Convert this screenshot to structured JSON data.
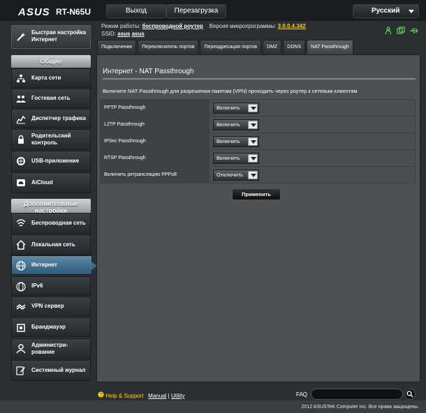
{
  "header": {
    "logo": "ASUS",
    "model": "RT-N65U",
    "logout_label": "Выход",
    "reboot_label": "Перезагрузка",
    "language": "Русский"
  },
  "status": {
    "mode_label": "Режим работы:",
    "mode_value": "беспроводной роутер",
    "firmware_label": "Версия микропрограммы:",
    "firmware_value": "3.0.0.4.342",
    "ssid_label": "SSID:",
    "ssid_1": "asus",
    "ssid_2": "asus"
  },
  "sidebar": {
    "quick_setup": "Быстрая настройка Интернет",
    "general_title": "Общие",
    "general_items": [
      {
        "label": "Карта сети"
      },
      {
        "label": "Гостевая сеть"
      },
      {
        "label": "Диспетчер трафика"
      },
      {
        "label": "Родительский контроль"
      },
      {
        "label": "USB-приложение"
      },
      {
        "label": "AiCloud"
      }
    ],
    "advanced_title": "Дополнительные настройки",
    "advanced_items": [
      {
        "label": "Беспроводная сеть"
      },
      {
        "label": "Локальная сеть"
      },
      {
        "label": "Интернет"
      },
      {
        "label": "IPv6"
      },
      {
        "label": "VPN сервер"
      },
      {
        "label": "Брандмауэр"
      },
      {
        "label": "Администри-рование"
      },
      {
        "label": "Системный журнал"
      }
    ]
  },
  "tabs": [
    {
      "label": "Подключение"
    },
    {
      "label": "Переключатель портов"
    },
    {
      "label": "Переадресация портов"
    },
    {
      "label": "DMZ"
    },
    {
      "label": "DDNS"
    },
    {
      "label": "NAT Passthrough"
    }
  ],
  "main": {
    "title": "Интернет - NAT Passthrough",
    "description": "Включите NAT Passthrough для разрешения пакетам (VPN) проходить через роутер к сетевым клиентам",
    "rows": [
      {
        "label": "PPTP Passthrough",
        "value": "Включить"
      },
      {
        "label": "L2TP Passthrough",
        "value": "Включить"
      },
      {
        "label": "IPSec Passthrough",
        "value": "Включить"
      },
      {
        "label": "RTSP Passthrough",
        "value": "Включить"
      },
      {
        "label": "Включить ретрансляцию PPPoE",
        "value": "Отключить"
      }
    ],
    "apply_label": "Применить"
  },
  "footer": {
    "help": "Help & Support",
    "manual": "Manual",
    "separator": "|",
    "utility": "Utility",
    "faq": "FAQ",
    "copyright": "2012 ASUSTeK Computer Inc. Все права защищены."
  },
  "colors": {
    "accent": "#ffd400",
    "active_nav": "#3d6a8a",
    "panel": "#4d5154"
  }
}
